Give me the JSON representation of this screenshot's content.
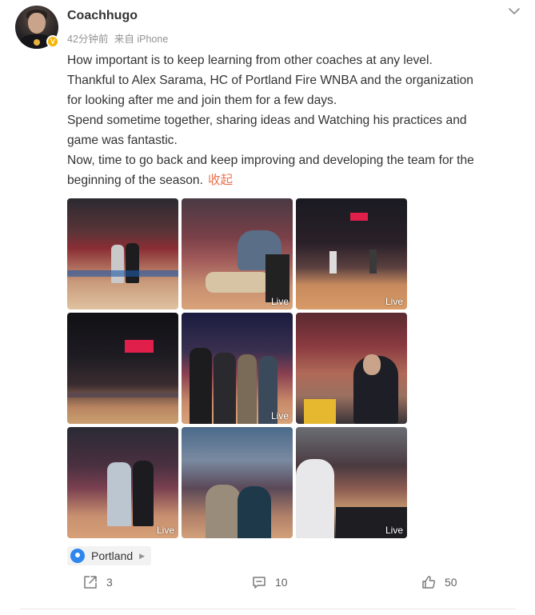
{
  "post": {
    "username": "Coachhugo",
    "time": "42分钟前",
    "source": "来自 iPhone",
    "text_lines": [
      "How important is to keep learning from other coaches at any level.",
      "Thankful to Alex Sarama, HC of Portland Fire WNBA and the organization",
      "for looking after me and join them for a few days.",
      "Spend sometime together, sharing ideas and Watching his practices and",
      "game was fantastic.",
      "Now, time to go back and keep improving and developing the team for the",
      "beginning of the season."
    ],
    "collapse_label": "收起",
    "verified_badge": "V",
    "photos": [
      {
        "live": ""
      },
      {
        "live": "Live"
      },
      {
        "live": "Live"
      },
      {
        "live": ""
      },
      {
        "live": "Live"
      },
      {
        "live": ""
      },
      {
        "live": "Live"
      },
      {
        "live": ""
      },
      {
        "live": "Live"
      }
    ],
    "location": "Portland"
  },
  "actions": {
    "share_count": "3",
    "comment_count": "10",
    "like_count": "50"
  },
  "icons": {
    "more": "chevron-down-icon",
    "location": "location-pin-icon",
    "share": "share-icon",
    "comment": "comment-icon",
    "like": "thumbs-up-icon"
  },
  "colors": {
    "accent": "#eb7350",
    "meta_gray": "#939393",
    "location_pin": "#2d87ee",
    "verified": "#f5b400"
  }
}
